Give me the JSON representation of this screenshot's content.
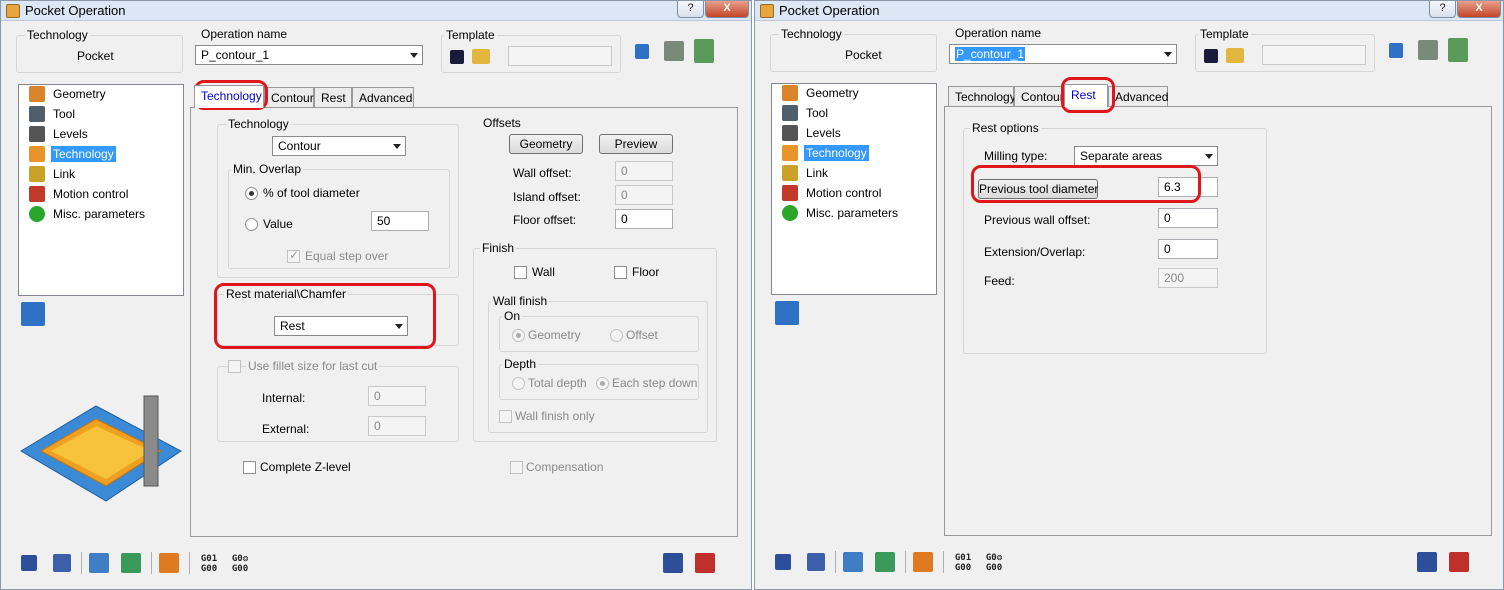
{
  "title": "Pocket Operation",
  "titlebar_buttons": {
    "help": "?",
    "close": "X"
  },
  "header": {
    "technology_caption": "Technology",
    "technology_value": "Pocket",
    "operation_name_caption": "Operation name",
    "operation_name_value": "P_contour_1",
    "template_caption": "Template"
  },
  "tree": [
    "Geometry",
    "Tool",
    "Levels",
    "Technology",
    "Link",
    "Motion control",
    "Misc. parameters"
  ],
  "tabs": [
    "Technology",
    "Contour",
    "Rest",
    "Advanced"
  ],
  "technology_tab": {
    "technology_caption": "Technology",
    "technology_combo": "Contour",
    "min_overlap_caption": "Min. Overlap",
    "pct_tool_label": "% of tool diameter",
    "value_label": "Value",
    "value_input": "50",
    "equal_step_label": "Equal step over",
    "offsets_caption": "Offsets",
    "geometry_button": "Geometry",
    "preview_button": "Preview",
    "wall_offset_label": "Wall offset:",
    "wall_offset_value": "0",
    "island_offset_label": "Island offset:",
    "island_offset_value": "0",
    "floor_offset_label": "Floor offset:",
    "floor_offset_value": "0",
    "rest_chamfer_caption": "Rest material\\Chamfer",
    "rest_combo": "Rest",
    "finish_caption": "Finish",
    "wall_label": "Wall",
    "floor_label": "Floor",
    "wall_finish_caption": "Wall finish",
    "on_caption": "On",
    "geometry_radio": "Geometry",
    "offset_radio": "Offset",
    "depth_caption": "Depth",
    "total_depth_radio": "Total depth",
    "each_step_radio": "Each step down",
    "wall_finish_only_label": "Wall finish only",
    "fillet_label": "Use fillet size for last cut",
    "internal_label": "Internal:",
    "internal_value": "0",
    "external_label": "External:",
    "external_value": "0",
    "complete_z_label": "Complete Z-level",
    "compensation_label": "Compensation"
  },
  "rest_tab": {
    "rest_options_caption": "Rest options",
    "milling_type_label": "Milling type:",
    "milling_type_value": "Separate areas",
    "prev_tool_button": "Previous tool diameter",
    "prev_tool_value": "6.3",
    "prev_wall_label": "Previous wall offset:",
    "prev_wall_value": "0",
    "ext_overlap_label": "Extension/Overlap:",
    "ext_overlap_value": "0",
    "feed_label": "Feed:",
    "feed_value": "200"
  },
  "gcode_buttons": [
    {
      "line1": "G01",
      "line2": "G00"
    },
    {
      "line1": "G0❂",
      "line2": "G00"
    }
  ],
  "colors": {
    "accent": "#3399ff",
    "highlight": "#e0161c",
    "tab_active_text": "#0000d0"
  }
}
